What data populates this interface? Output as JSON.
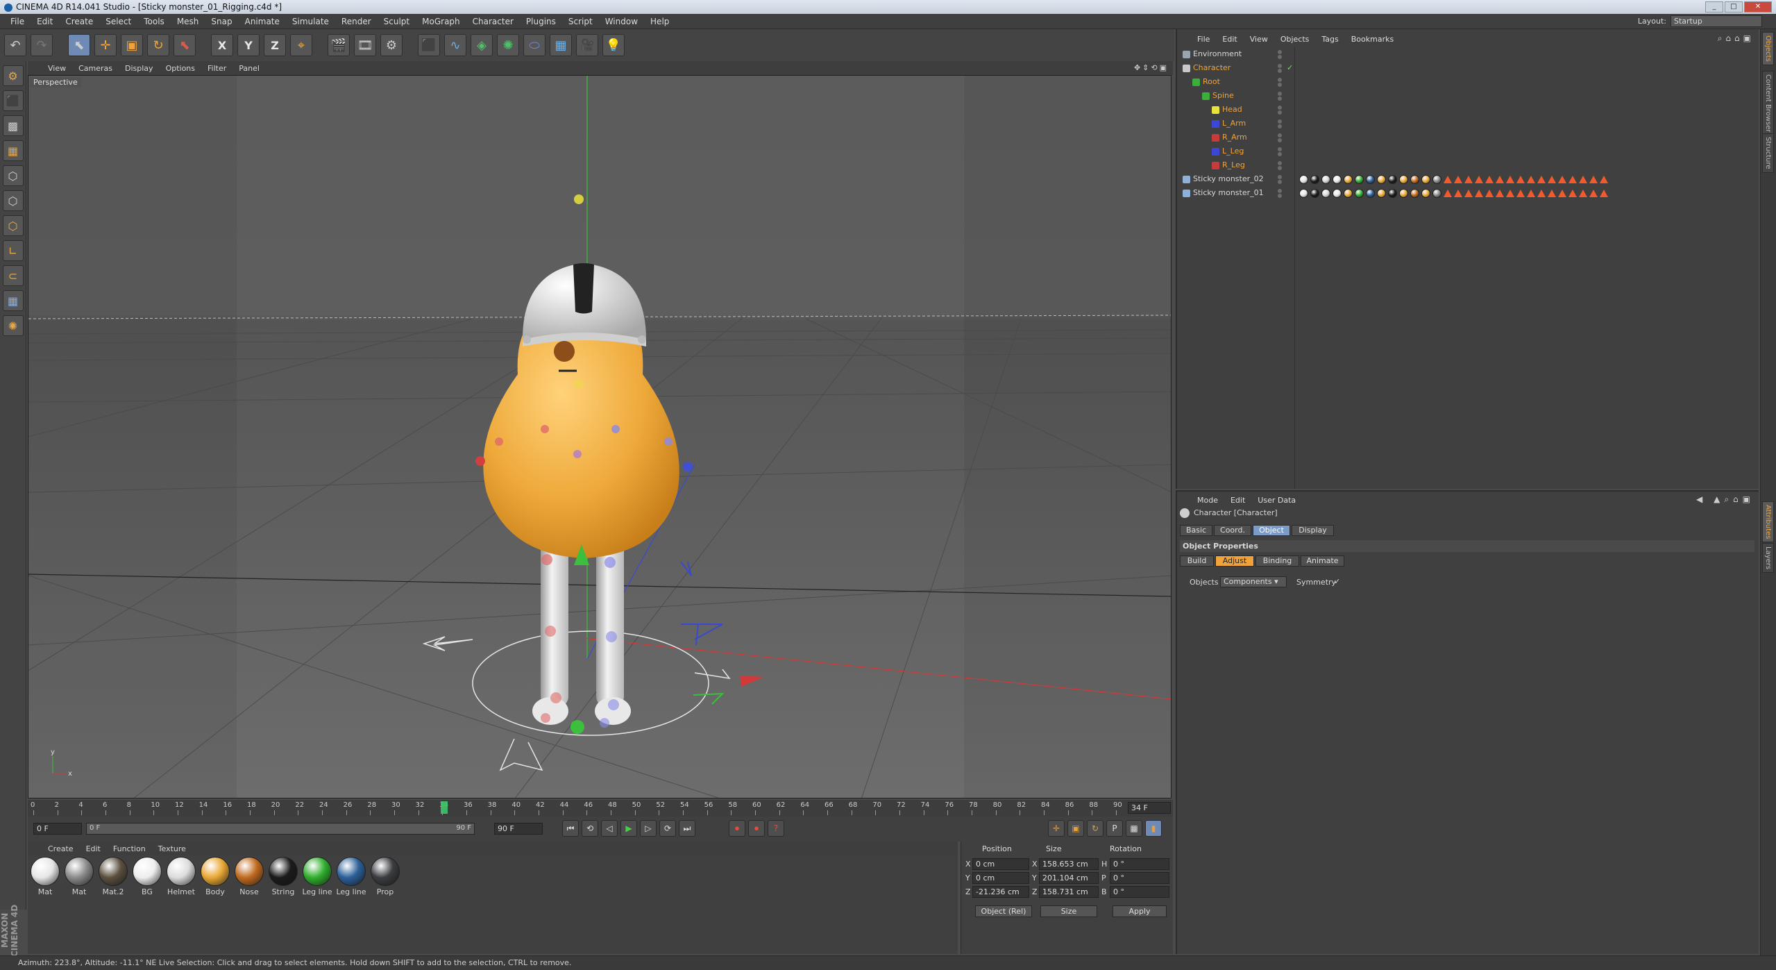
{
  "window": {
    "title": "CINEMA 4D R14.041 Studio - [Sticky monster_01_Rigging.c4d *]"
  },
  "menubar": [
    "File",
    "Edit",
    "Create",
    "Select",
    "Tools",
    "Mesh",
    "Snap",
    "Animate",
    "Simulate",
    "Render",
    "Sculpt",
    "MoGraph",
    "Character",
    "Plugins",
    "Script",
    "Window",
    "Help"
  ],
  "layout": {
    "label": "Layout:",
    "value": "Startup"
  },
  "toolbar": {
    "axis_x": "X",
    "axis_y": "Y",
    "axis_z": "Z"
  },
  "viewport": {
    "menu": [
      "View",
      "Cameras",
      "Display",
      "Options",
      "Filter",
      "Panel"
    ],
    "name": "Perspective"
  },
  "timeline": {
    "ticks": [
      "0",
      "2",
      "4",
      "6",
      "8",
      "10",
      "12",
      "14",
      "16",
      "18",
      "20",
      "22",
      "24",
      "26",
      "28",
      "30",
      "32",
      "34",
      "36",
      "38",
      "40",
      "42",
      "44",
      "46",
      "48",
      "50",
      "52",
      "54",
      "56",
      "58",
      "60",
      "62",
      "64",
      "66",
      "68",
      "70",
      "72",
      "74",
      "76",
      "78",
      "80",
      "82",
      "84",
      "86",
      "88",
      "90"
    ],
    "current_frame": "34 F",
    "start": "0 F",
    "min_field": "0 F",
    "max_field": "90 F",
    "end": "90 F",
    "playhead_frame": 34,
    "max_frame": 90
  },
  "materials": {
    "menu": [
      "Create",
      "Edit",
      "Function",
      "Texture"
    ],
    "items": [
      {
        "label": "Mat",
        "color": "#e6e6e6"
      },
      {
        "label": "Mat",
        "color": "#8a8a8a"
      },
      {
        "label": "Mat.2",
        "color": "#5b5040"
      },
      {
        "label": "BG",
        "color": "#ededed"
      },
      {
        "label": "Helmet",
        "color": "#dcdcdc"
      },
      {
        "label": "Body",
        "color": "#e9a734"
      },
      {
        "label": "Nose",
        "color": "#c06a1f"
      },
      {
        "label": "String",
        "color": "#1b1b1b"
      },
      {
        "label": "Leg line",
        "color": "#2fae2c"
      },
      {
        "label": "Leg line",
        "color": "#2b5f98"
      },
      {
        "label": "Prop",
        "color": "#3b3d40"
      }
    ]
  },
  "coord": {
    "headers": {
      "position": "Position",
      "size": "Size",
      "rotation": "Rotation"
    },
    "rows": [
      {
        "axis": "X",
        "pos": "0 cm",
        "size_axis": "X",
        "size": "158.653 cm",
        "rot_axis": "H",
        "rot": "0 °"
      },
      {
        "axis": "Y",
        "pos": "0 cm",
        "size_axis": "Y",
        "size": "201.104 cm",
        "rot_axis": "P",
        "rot": "0 °"
      },
      {
        "axis": "Z",
        "pos": "-21.236 cm",
        "size_axis": "Z",
        "size": "158.731 cm",
        "rot_axis": "B",
        "rot": "0 °"
      }
    ],
    "mode": "Object (Rel)",
    "size_mode": "Size",
    "apply": "Apply"
  },
  "status": "Azimuth: 223.8°, Altitude: -11.1°  NE     Live Selection: Click and drag to select elements. Hold down SHIFT to add to the selection, CTRL to remove.",
  "object_manager": {
    "menu": [
      "File",
      "Edit",
      "View",
      "Objects",
      "Tags",
      "Bookmarks"
    ],
    "objects": [
      {
        "name": "Environment",
        "indent": 0,
        "orange": false,
        "icon_color": "#9aa5b0"
      },
      {
        "name": "Character",
        "indent": 0,
        "orange": true,
        "icon_color": "#c9c9c9"
      },
      {
        "name": "Root",
        "indent": 1,
        "orange": true,
        "icon_color": "#3cae3a"
      },
      {
        "name": "Spine",
        "indent": 2,
        "orange": true,
        "icon_color": "#3cae3a"
      },
      {
        "name": "Head",
        "indent": 3,
        "orange": true,
        "icon_color": "#e8e23a"
      },
      {
        "name": "L_Arm",
        "indent": 3,
        "orange": true,
        "icon_color": "#3b47d6"
      },
      {
        "name": "R_Arm",
        "indent": 3,
        "orange": true,
        "icon_color": "#c63b3b"
      },
      {
        "name": "L_Leg",
        "indent": 3,
        "orange": true,
        "icon_color": "#3b47d6"
      },
      {
        "name": "R_Leg",
        "indent": 3,
        "orange": true,
        "icon_color": "#c63b3b"
      },
      {
        "name": "Sticky monster_02",
        "indent": 0,
        "orange": false,
        "icon_color": "#8fb0d8"
      },
      {
        "name": "Sticky monster_01",
        "indent": 0,
        "orange": false,
        "icon_color": "#8fb0d8"
      }
    ]
  },
  "attribute_manager": {
    "menu": [
      "Mode",
      "Edit",
      "User Data"
    ],
    "title": "Character [Character]",
    "tabs": [
      "Basic",
      "Coord.",
      "Object",
      "Display"
    ],
    "section": "Object Properties",
    "subtabs": [
      "Build",
      "Adjust",
      "Binding",
      "Animate"
    ],
    "objects_label": "Objects",
    "objects_value": "Components",
    "symmetry_label": "Symmetry",
    "symmetry_check": "✓"
  },
  "right_tabs": [
    "Objects",
    "Content Browser",
    "Structure",
    "Attributes",
    "Layers"
  ]
}
